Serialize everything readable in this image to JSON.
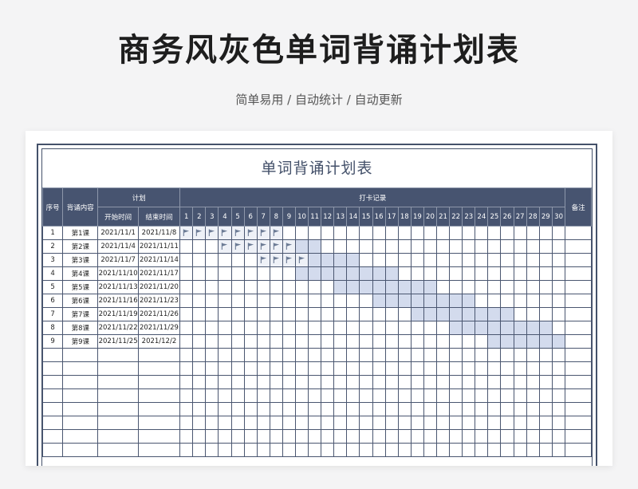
{
  "page": {
    "title": "商务风灰色单词背诵计划表",
    "subtitle": "简单易用 / 自动统计 / 自动更新"
  },
  "sheet": {
    "title": "单词背诵计划表",
    "headers": {
      "seq": "序号",
      "content": "背诵内容",
      "plan": "计划",
      "start": "开始时间",
      "end": "结束时间",
      "checkin": "打卡记录",
      "note": "备注"
    },
    "days": [
      "1",
      "2",
      "3",
      "4",
      "5",
      "6",
      "7",
      "8",
      "9",
      "10",
      "11",
      "12",
      "13",
      "14",
      "15",
      "16",
      "17",
      "18",
      "19",
      "20",
      "21",
      "22",
      "23",
      "24",
      "25",
      "26",
      "27",
      "28",
      "29",
      "30"
    ],
    "rows": [
      {
        "seq": "1",
        "content": "第1课",
        "start": "2021/11/1",
        "end": "2021/11/8",
        "range": [
          1,
          8
        ],
        "checked": [
          1,
          2,
          3,
          4,
          5,
          6,
          7,
          8
        ]
      },
      {
        "seq": "2",
        "content": "第2课",
        "start": "2021/11/4",
        "end": "2021/11/11",
        "range": [
          4,
          11
        ],
        "checked": [
          4,
          5,
          6,
          7,
          8,
          9
        ]
      },
      {
        "seq": "3",
        "content": "第3课",
        "start": "2021/11/7",
        "end": "2021/11/14",
        "range": [
          7,
          14
        ],
        "checked": [
          7,
          8,
          9,
          10
        ]
      },
      {
        "seq": "4",
        "content": "第4课",
        "start": "2021/11/10",
        "end": "2021/11/17",
        "range": [
          10,
          17
        ],
        "checked": []
      },
      {
        "seq": "5",
        "content": "第5课",
        "start": "2021/11/13",
        "end": "2021/11/20",
        "range": [
          13,
          20
        ],
        "checked": []
      },
      {
        "seq": "6",
        "content": "第6课",
        "start": "2021/11/16",
        "end": "2021/11/23",
        "range": [
          16,
          23
        ],
        "checked": []
      },
      {
        "seq": "7",
        "content": "第7课",
        "start": "2021/11/19",
        "end": "2021/11/26",
        "range": [
          19,
          26
        ],
        "checked": []
      },
      {
        "seq": "8",
        "content": "第8课",
        "start": "2021/11/22",
        "end": "2021/11/29",
        "range": [
          22,
          29
        ],
        "checked": []
      },
      {
        "seq": "9",
        "content": "第9课",
        "start": "2021/11/25",
        "end": "2021/12/2",
        "range": [
          25,
          30
        ],
        "checked": []
      }
    ],
    "empty_rows": 8,
    "colors": {
      "header": "#475470",
      "highlight": "#d3dbed",
      "flag": "#6b7a94"
    },
    "check_icon": "flag-icon"
  }
}
